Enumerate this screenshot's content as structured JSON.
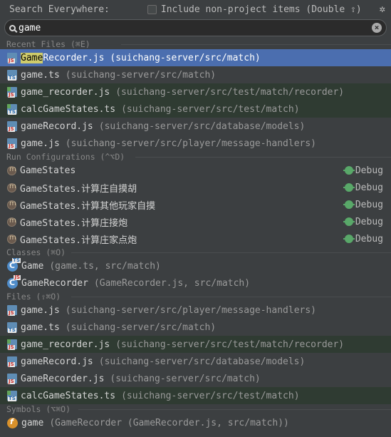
{
  "header": {
    "title": "Search Everywhere:",
    "include_label": "Include non-project items (Double ⇧)",
    "include_checked": false
  },
  "search": {
    "value": "game"
  },
  "sections": {
    "recent": "Recent Files (⌘E)",
    "run": "Run Configurations (^⌥D)",
    "classes": "Classes (⌘O)",
    "files": "Files (⇧⌘O)",
    "symbols": "Symbols (⌥⌘O)"
  },
  "recent_files": [
    {
      "match": "Game",
      "rest": "Recorder.js",
      "path": "(suichang-server/src/match)"
    },
    {
      "name": "game.ts",
      "path": "(suichang-server/src/match)"
    },
    {
      "name": "game_recorder.js",
      "path": "(suichang-server/src/test/match/recorder)"
    },
    {
      "name": "calcGameStates.ts",
      "path": "(suichang-server/src/test/match)"
    },
    {
      "name": "gameRecord.js",
      "path": "(suichang-server/src/database/models)"
    },
    {
      "name": "game.js",
      "path": "(suichang-server/src/player/message-handlers)"
    }
  ],
  "run_configs": [
    {
      "name": "GameStates",
      "action": "Debug"
    },
    {
      "name": "GameStates.计算庄自摸胡",
      "action": "Debug"
    },
    {
      "name": "GameStates.计算其他玩家自摸",
      "action": "Debug"
    },
    {
      "name": "GameStates.计算庄接炮",
      "action": "Debug"
    },
    {
      "name": "GameStates.计算庄家点炮",
      "action": "Debug"
    }
  ],
  "classes": [
    {
      "name": "Game",
      "path": "(game.ts, src/match)",
      "tag": "TS"
    },
    {
      "name": "GameRecorder",
      "path": "(GameRecorder.js, src/match)",
      "tag": "JS"
    }
  ],
  "files": [
    {
      "name": "game.js",
      "path": "(suichang-server/src/player/message-handlers)"
    },
    {
      "name": "game.ts",
      "path": "(suichang-server/src/match)"
    },
    {
      "name": "game_recorder.js",
      "path": "(suichang-server/src/test/match/recorder)"
    },
    {
      "name": "gameRecord.js",
      "path": "(suichang-server/src/database/models)"
    },
    {
      "name": "GameRecorder.js",
      "path": "(suichang-server/src/match)"
    },
    {
      "name": "calcGameStates.ts",
      "path": "(suichang-server/src/test/match)"
    }
  ],
  "symbols": [
    {
      "name": "game",
      "path": "(GameRecorder (GameRecorder.js, src/match))"
    }
  ],
  "colors": {
    "background": "#3c3f41",
    "selection": "#4b6eaf",
    "test_row": "#2f3b32",
    "match_highlight": "#cfcc6b"
  }
}
